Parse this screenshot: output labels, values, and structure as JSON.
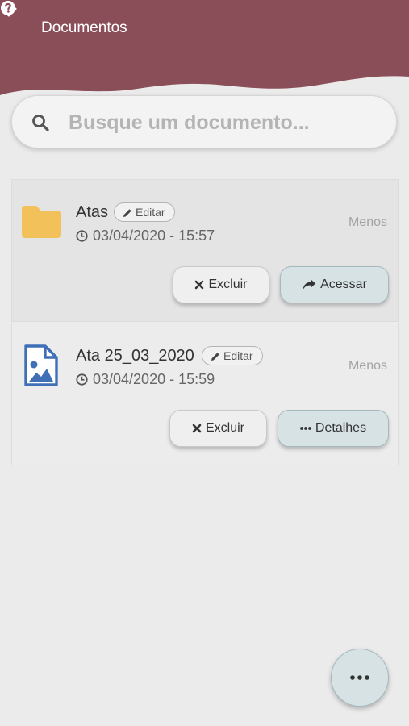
{
  "colors": {
    "header_bg": "#8a4e58",
    "page_bg": "#ebebeb",
    "folder": "#f2c15a",
    "image_icon": "#3e6fb7",
    "action_button_bg": "#d7e2e5"
  },
  "header": {
    "back_icon": "arrow-left-icon",
    "title": "Documentos",
    "help_icon": "question-circle-icon"
  },
  "search": {
    "icon": "search-icon",
    "placeholder": "Busque um documento..."
  },
  "items": [
    {
      "type": "folder",
      "icon": "folder-icon",
      "name": "Atas",
      "edit_label": "Editar",
      "date": "03/04/2020 - 15:57",
      "less_label": "Menos",
      "delete_label": "Excluir",
      "action_label": "Acessar",
      "action_icon": "share-arrow-icon"
    },
    {
      "type": "image",
      "icon": "image-file-icon",
      "name": "Ata 25_03_2020",
      "edit_label": "Editar",
      "date": "03/04/2020 - 15:59",
      "less_label": "Menos",
      "delete_label": "Excluir",
      "action_label": "Detalhes",
      "action_icon": "ellipsis-icon"
    }
  ],
  "fab": {
    "icon": "ellipsis-icon"
  }
}
